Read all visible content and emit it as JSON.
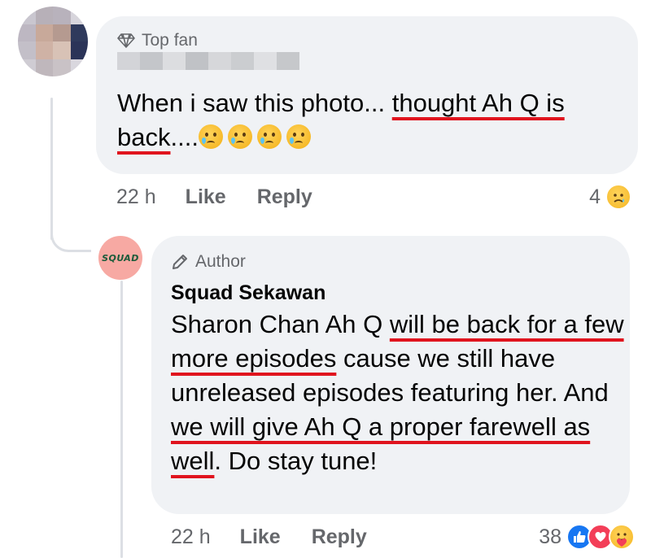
{
  "comment": {
    "badge": "Top fan",
    "text_before": "When i saw this photo... ",
    "text_underlined": "thought Ah Q is back",
    "text_after": "....",
    "emojis": [
      "crying-face-emoji",
      "crying-face-emoji",
      "crying-face-emoji",
      "crying-face-emoji"
    ],
    "time": "22 h",
    "like_label": "Like",
    "reply_label": "Reply",
    "reaction_count": "4",
    "reactions": [
      "sad-reaction-icon"
    ]
  },
  "reply": {
    "badge": "Author",
    "author": "Squad Sekawan",
    "avatar_logo": "SQUAD",
    "seg1": "Sharon Chan Ah Q ",
    "seg2": "will be back for a few more episodes",
    "seg3": " cause we still have unreleased episodes featuring her. And ",
    "seg4": "we will give Ah Q a proper farewell as well",
    "seg5": ". Do stay tune!",
    "time": "22 h",
    "like_label": "Like",
    "reply_label": "Reply",
    "reaction_count": "38",
    "reactions": [
      "like-reaction-icon",
      "love-reaction-icon",
      "care-reaction-icon"
    ]
  },
  "colors": {
    "bubble_bg": "#f0f2f5",
    "underline": "#e0141e",
    "meta_text": "#65676b",
    "like_blue": "#1877f2",
    "love_red": "#f33e58"
  }
}
